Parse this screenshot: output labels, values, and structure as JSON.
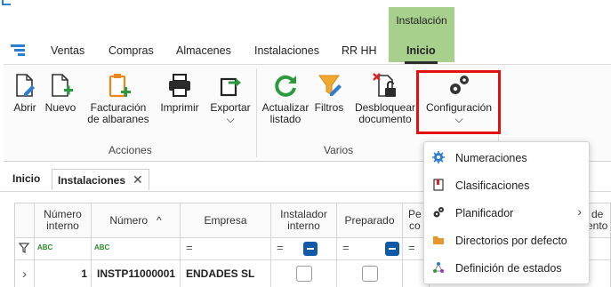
{
  "context_tab": {
    "label": "Instalación"
  },
  "menubar": {
    "tabs": [
      "Ventas",
      "Compras",
      "Almacenes",
      "Instalaciones",
      "RR HH",
      "Inicio"
    ],
    "active": "Inicio"
  },
  "ribbon": {
    "buttons": {
      "abrir": "Abrir",
      "nuevo": "Nuevo",
      "facturacion_1": "Facturación",
      "facturacion_2": "de albaranes",
      "imprimir": "Imprimir",
      "exportar": "Exportar",
      "exportar_caret": "⌵",
      "actualizar_1": "Actualizar",
      "actualizar_2": "listado",
      "filtros": "Filtros",
      "desbloquear_1": "Desbloquear",
      "desbloquear_2": "documento",
      "configuracion": "Configuración",
      "configuracion_caret": "⌵"
    },
    "groups": {
      "acciones": "Acciones",
      "varios": "Varios"
    }
  },
  "doc_tabs": {
    "inicio": "Inicio",
    "instalaciones": "Instalaciones",
    "close": "✕"
  },
  "grid": {
    "columns": {
      "numero_interno_1": "Número",
      "numero_interno_2": "interno",
      "numero": "Número",
      "empresa": "Empresa",
      "instalador_1": "Instalador",
      "instalador_2": "interno",
      "preparado": "Preparado",
      "pe_1": "Pe",
      "pe_2": "co",
      "right_1": "de",
      "right_2": "ento"
    },
    "sort_indicator": "^",
    "filter_abc": "ABC",
    "filter_eq": "=",
    "row": {
      "expander": "›",
      "numero_interno": "1",
      "numero": "INSTP11000001",
      "empresa": "ENDADES SL"
    }
  },
  "dropdown": {
    "items": [
      {
        "label": "Numeraciones",
        "icon": "gear-icon",
        "submenu": false
      },
      {
        "label": "Clasificaciones",
        "icon": "book-icon",
        "submenu": false
      },
      {
        "label": "Planificador",
        "icon": "gears-icon",
        "submenu": true
      },
      {
        "label": "Directorios por defecto",
        "icon": "folder-icon",
        "submenu": false
      },
      {
        "label": "Definición de estados",
        "icon": "network-icon",
        "submenu": false
      }
    ],
    "submenu_arrow": "›"
  },
  "colors": {
    "accent_blue": "#2d7dd2",
    "highlight_red": "#e31010",
    "context_green": "#a8d08d",
    "toggle_blue": "#0e5aa7"
  }
}
